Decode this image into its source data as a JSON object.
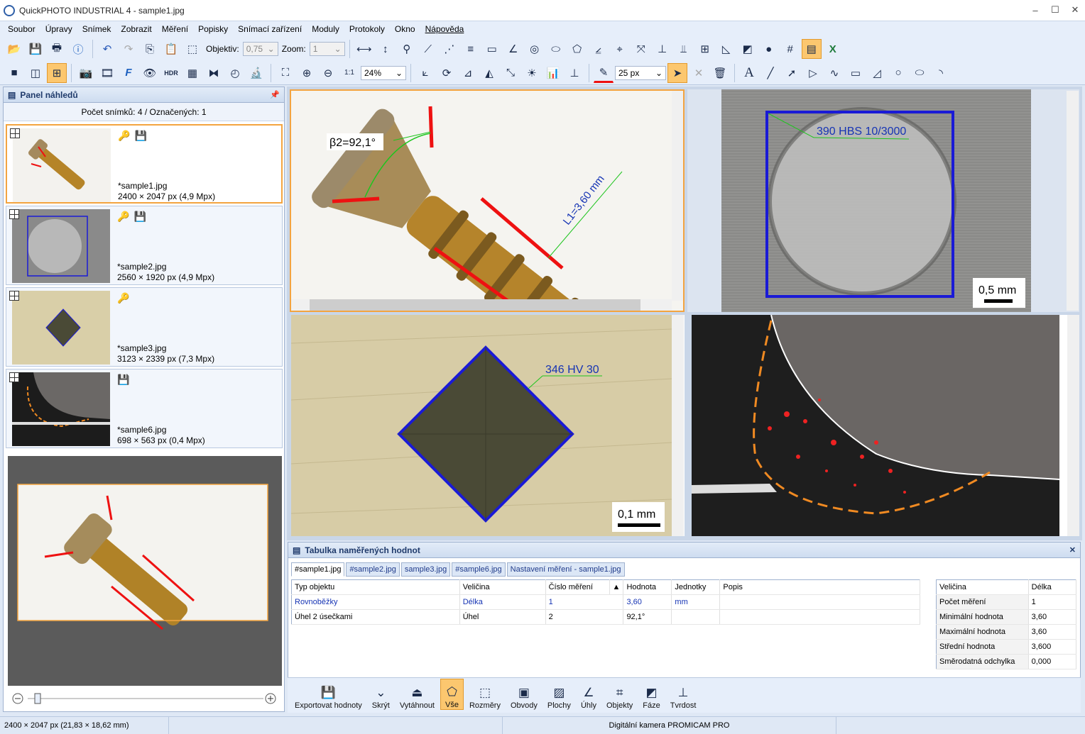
{
  "window": {
    "title": "QuickPHOTO INDUSTRIAL 4 - sample1.jpg",
    "minimize": "–",
    "maximize": "☐",
    "close": "✕"
  },
  "menu": [
    "Soubor",
    "Úpravy",
    "Snímek",
    "Zobrazit",
    "Měření",
    "Popisky",
    "Snímací zařízení",
    "Moduly",
    "Protokoly",
    "Okno",
    "Nápověda"
  ],
  "toolbar1": {
    "objective_label": "Objektiv:",
    "objective_value": "0,75",
    "zoom_label": "Zoom:",
    "zoom_value": "1"
  },
  "toolbar2": {
    "zoom_percent": "24%",
    "line_width": "25 px",
    "hdr": "HDR",
    "one_to_one": "1:1",
    "text_tool": "A"
  },
  "left_panel": {
    "title": "Panel náhledů",
    "pin": "📌",
    "count_text": "Počet snímků: 4 / Označených: 1",
    "thumbs": [
      {
        "name": "*sample1.jpg",
        "dims": "2400 × 2047 px (4,9 Mpx)"
      },
      {
        "name": "*sample2.jpg",
        "dims": "2560 × 1920 px (4,9 Mpx)"
      },
      {
        "name": "*sample3.jpg",
        "dims": "3123 × 2339 px (7,3 Mpx)"
      },
      {
        "name": "*sample6.jpg",
        "dims": "698 × 563 px (0,4 Mpx)"
      }
    ]
  },
  "views": {
    "screw": {
      "angle_label": "β2=92,1°",
      "length_label": "L1=3,60 mm"
    },
    "brinell": {
      "label": "390 HBS 10/3000",
      "scale": "0,5 mm"
    },
    "vickers": {
      "label": "346 HV 30",
      "scale": "0,1 mm"
    }
  },
  "results": {
    "title": "Tabulka naměřených hodnot",
    "close": "✕",
    "tabs": [
      "#sample1.jpg",
      "#sample2.jpg",
      "sample3.jpg",
      "#sample6.jpg",
      "Nastavení měření - sample1.jpg"
    ],
    "columns": [
      "Typ objektu",
      "Veličina",
      "Číslo měření",
      "▲",
      "Hodnota",
      "Jednotky",
      "Popis"
    ],
    "rows": [
      [
        "Rovnoběžky",
        "Délka",
        "1",
        "3,60",
        "mm",
        ""
      ],
      [
        "Úhel 2 úsečkami",
        "Úhel",
        "2",
        "92,1°",
        "",
        ""
      ]
    ],
    "stats_header": [
      "Veličina",
      "Délka"
    ],
    "stats": [
      [
        "Počet měření",
        "1"
      ],
      [
        "Minimální hodnota",
        "3,60"
      ],
      [
        "Maximální hodnota",
        "3,60"
      ],
      [
        "Střední hodnota",
        "3,600"
      ],
      [
        "Směrodatná odchylka",
        "0,000"
      ]
    ]
  },
  "bottom_buttons": [
    "Exportovat hodnoty",
    "Skrýt",
    "Vytáhnout",
    "Vše",
    "Rozměry",
    "Obvody",
    "Plochy",
    "Úhly",
    "Objekty",
    "Fáze",
    "Tvrdost"
  ],
  "statusbar": {
    "image_size": "2400 × 2047 px (21,83 × 18,62 mm)",
    "camera": "Digitální kamera PROMICAM PRO"
  },
  "colors": {
    "accent_orange": "#f3a440",
    "measure_red": "#ee1111",
    "measure_blue": "#1a1ad6",
    "label_blue": "#1634b4"
  }
}
